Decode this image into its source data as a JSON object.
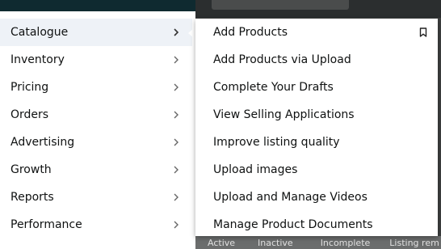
{
  "background": {
    "tabs": [
      "Active",
      "Inactive",
      "Incomplete",
      "Listing rem"
    ]
  },
  "left_menu": {
    "items": [
      {
        "label": "Catalogue",
        "active": true
      },
      {
        "label": "Inventory",
        "active": false
      },
      {
        "label": "Pricing",
        "active": false
      },
      {
        "label": "Orders",
        "active": false
      },
      {
        "label": "Advertising",
        "active": false
      },
      {
        "label": "Growth",
        "active": false
      },
      {
        "label": "Reports",
        "active": false
      },
      {
        "label": "Performance",
        "active": false
      }
    ],
    "chevron_icon": "chevron-right-icon"
  },
  "sub_menu": {
    "items": [
      {
        "label": "Add Products",
        "bookmarked": true
      },
      {
        "label": "Add Products via Upload"
      },
      {
        "label": "Complete Your Drafts"
      },
      {
        "label": "View Selling Applications"
      },
      {
        "label": "Improve listing quality"
      },
      {
        "label": "Upload images"
      },
      {
        "label": "Upload and Manage Videos"
      },
      {
        "label": "Manage Product Documents"
      }
    ],
    "bookmark_icon": "bookmark-icon"
  },
  "colors": {
    "active_bg": "#eef2f7",
    "text": "#0f1111",
    "header_dark": "#0f2a30",
    "overlay_gray": "#3d3f3f"
  }
}
